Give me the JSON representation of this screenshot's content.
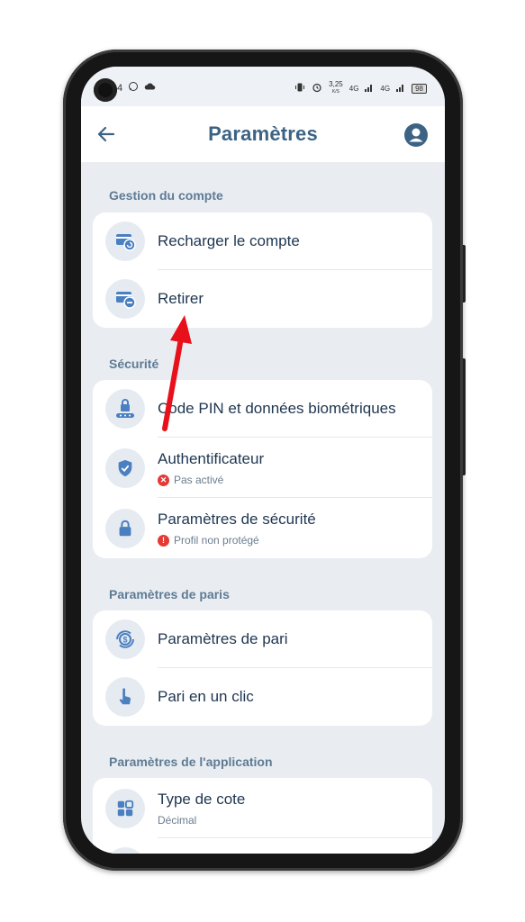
{
  "statusbar": {
    "time_fragment": "4",
    "speed": "3,25",
    "speed_unit": "K/S",
    "network1": "4G",
    "network2": "4G",
    "battery": "98"
  },
  "header": {
    "title": "Paramètres"
  },
  "sections": {
    "account": {
      "title": "Gestion du compte",
      "items": [
        {
          "label": "Recharger le compte"
        },
        {
          "label": "Retirer"
        }
      ]
    },
    "security": {
      "title": "Sécurité",
      "items": [
        {
          "label": "Code PIN et données biométriques"
        },
        {
          "label": "Authentificateur",
          "status": "Pas activé"
        },
        {
          "label": "Paramètres de sécurité",
          "status": "Profil non protégé"
        }
      ]
    },
    "betting": {
      "title": "Paramètres de paris",
      "items": [
        {
          "label": "Paramètres de pari"
        },
        {
          "label": "Pari en un clic"
        }
      ]
    },
    "app": {
      "title": "Paramètres de l'application",
      "items": [
        {
          "label": "Type de cote",
          "value": "Décimal"
        }
      ]
    }
  },
  "colors": {
    "accent": "#4a7fc0",
    "title": "#3d6384",
    "error_red": "#e53935",
    "annotation_arrow": "#e8111b"
  },
  "icons": {
    "back": "arrow-left-icon",
    "profile": "user-circle-icon",
    "recharge": "card-refresh-icon",
    "withdraw": "card-minus-icon",
    "pin": "lock-keypad-icon",
    "authenticator": "shield-check-icon",
    "security_settings": "lock-icon",
    "bet_settings": "coin-exchange-icon",
    "one_click": "hand-tap-icon",
    "odds_type": "grid-icon"
  }
}
